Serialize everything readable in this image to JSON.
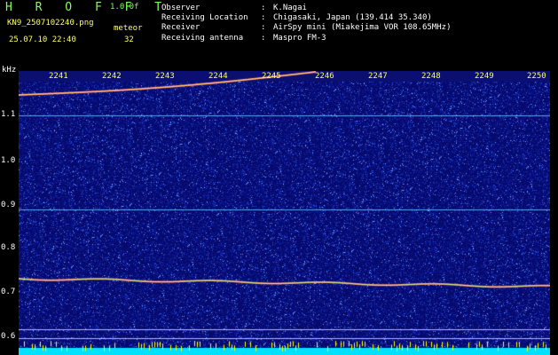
{
  "header": {
    "app_name": "H R O F F T",
    "version": "1.0.0f",
    "filename": "KN9_2507102240.png",
    "meteor_label": "meteor",
    "datetime": "25.07.10 22:40",
    "meteor_count": "32"
  },
  "info": [
    {
      "key": "Observer",
      "value": "K.Nagai"
    },
    {
      "key": "Receiving Location",
      "value": "Chigasaki, Japan (139.414 35.340)"
    },
    {
      "key": "Receiver",
      "value": "AirSpy mini (Miakejima VOR 108.65MHz)"
    },
    {
      "key": "Receiving antenna",
      "value": "Maspro FM-3"
    }
  ],
  "axis": {
    "unit": "kHz",
    "time_ticks": [
      "2241",
      "2242",
      "2243",
      "2244",
      "2245",
      "2246",
      "2247",
      "2248",
      "2249",
      "2250"
    ],
    "freq_ticks": [
      "1.1",
      "1.0",
      "0.9",
      "0.8",
      "0.7",
      "0.6"
    ]
  },
  "colors": {
    "background": "#000000",
    "spectrogram_bg": "#060a6e",
    "header_green": "#7fff5a",
    "header_yellow": "#ffff66",
    "header_white": "#ffffff"
  }
}
